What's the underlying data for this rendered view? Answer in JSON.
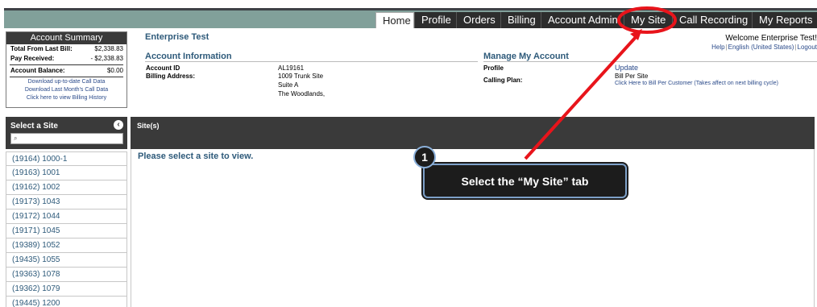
{
  "nav": {
    "tabs": [
      {
        "label": "Home",
        "active": true
      },
      {
        "label": "Profile"
      },
      {
        "label": "Orders"
      },
      {
        "label": "Billing"
      },
      {
        "label": "Account Admin"
      },
      {
        "label": "My Site"
      },
      {
        "label": "Call Recording"
      },
      {
        "label": "My Reports"
      }
    ]
  },
  "summary": {
    "title": "Account Summary",
    "total_label": "Total From Last Bill:",
    "total_value": "$2,338.83",
    "received_label": "Pay Received:",
    "received_value": "- $2,338.83",
    "balance_label": "Account Balance:",
    "balance_value": "$0.00",
    "links": [
      "Download up-to-date Call Data",
      "Download Last Month's Call Data",
      "Click here to view Billing History"
    ]
  },
  "header": {
    "title": "Enterprise Test",
    "welcome": "Welcome Enterprise Test!",
    "help": "Help",
    "language": "English (United States)",
    "logout": "Logout"
  },
  "account_info": {
    "title": "Account Information",
    "account_id_label": "Account ID",
    "account_id": "AL19161",
    "billing_label": "Billing Address:",
    "address_lines": [
      "1009 Trunk Site",
      "Suite A",
      "The Woodlands,"
    ]
  },
  "manage": {
    "title": "Manage My Account",
    "profile_label": "Profile",
    "update_link": "Update",
    "plan_label": "Calling Plan:",
    "plan_value": "Bill Per Site",
    "plan_link": "Click Here to Bill Per Customer (Takes affect on next billing cycle)"
  },
  "site_selector": {
    "title": "Select a Site",
    "search_placeholder": "",
    "sites": [
      "(19164) 1000-1",
      "(19163) 1001",
      "(19162) 1002",
      "(19173) 1043",
      "(19172) 1044",
      "(19171) 1045",
      "(19389) 1052",
      "(19435) 1055",
      "(19363) 1078",
      "(19362) 1079",
      "(19445) 1200"
    ]
  },
  "main": {
    "title": "Site(s)",
    "message": "Please select a site to view."
  },
  "annotation": {
    "step": "1",
    "text": "Select the “My Site” tab",
    "highlight_color": "#e8141b"
  }
}
